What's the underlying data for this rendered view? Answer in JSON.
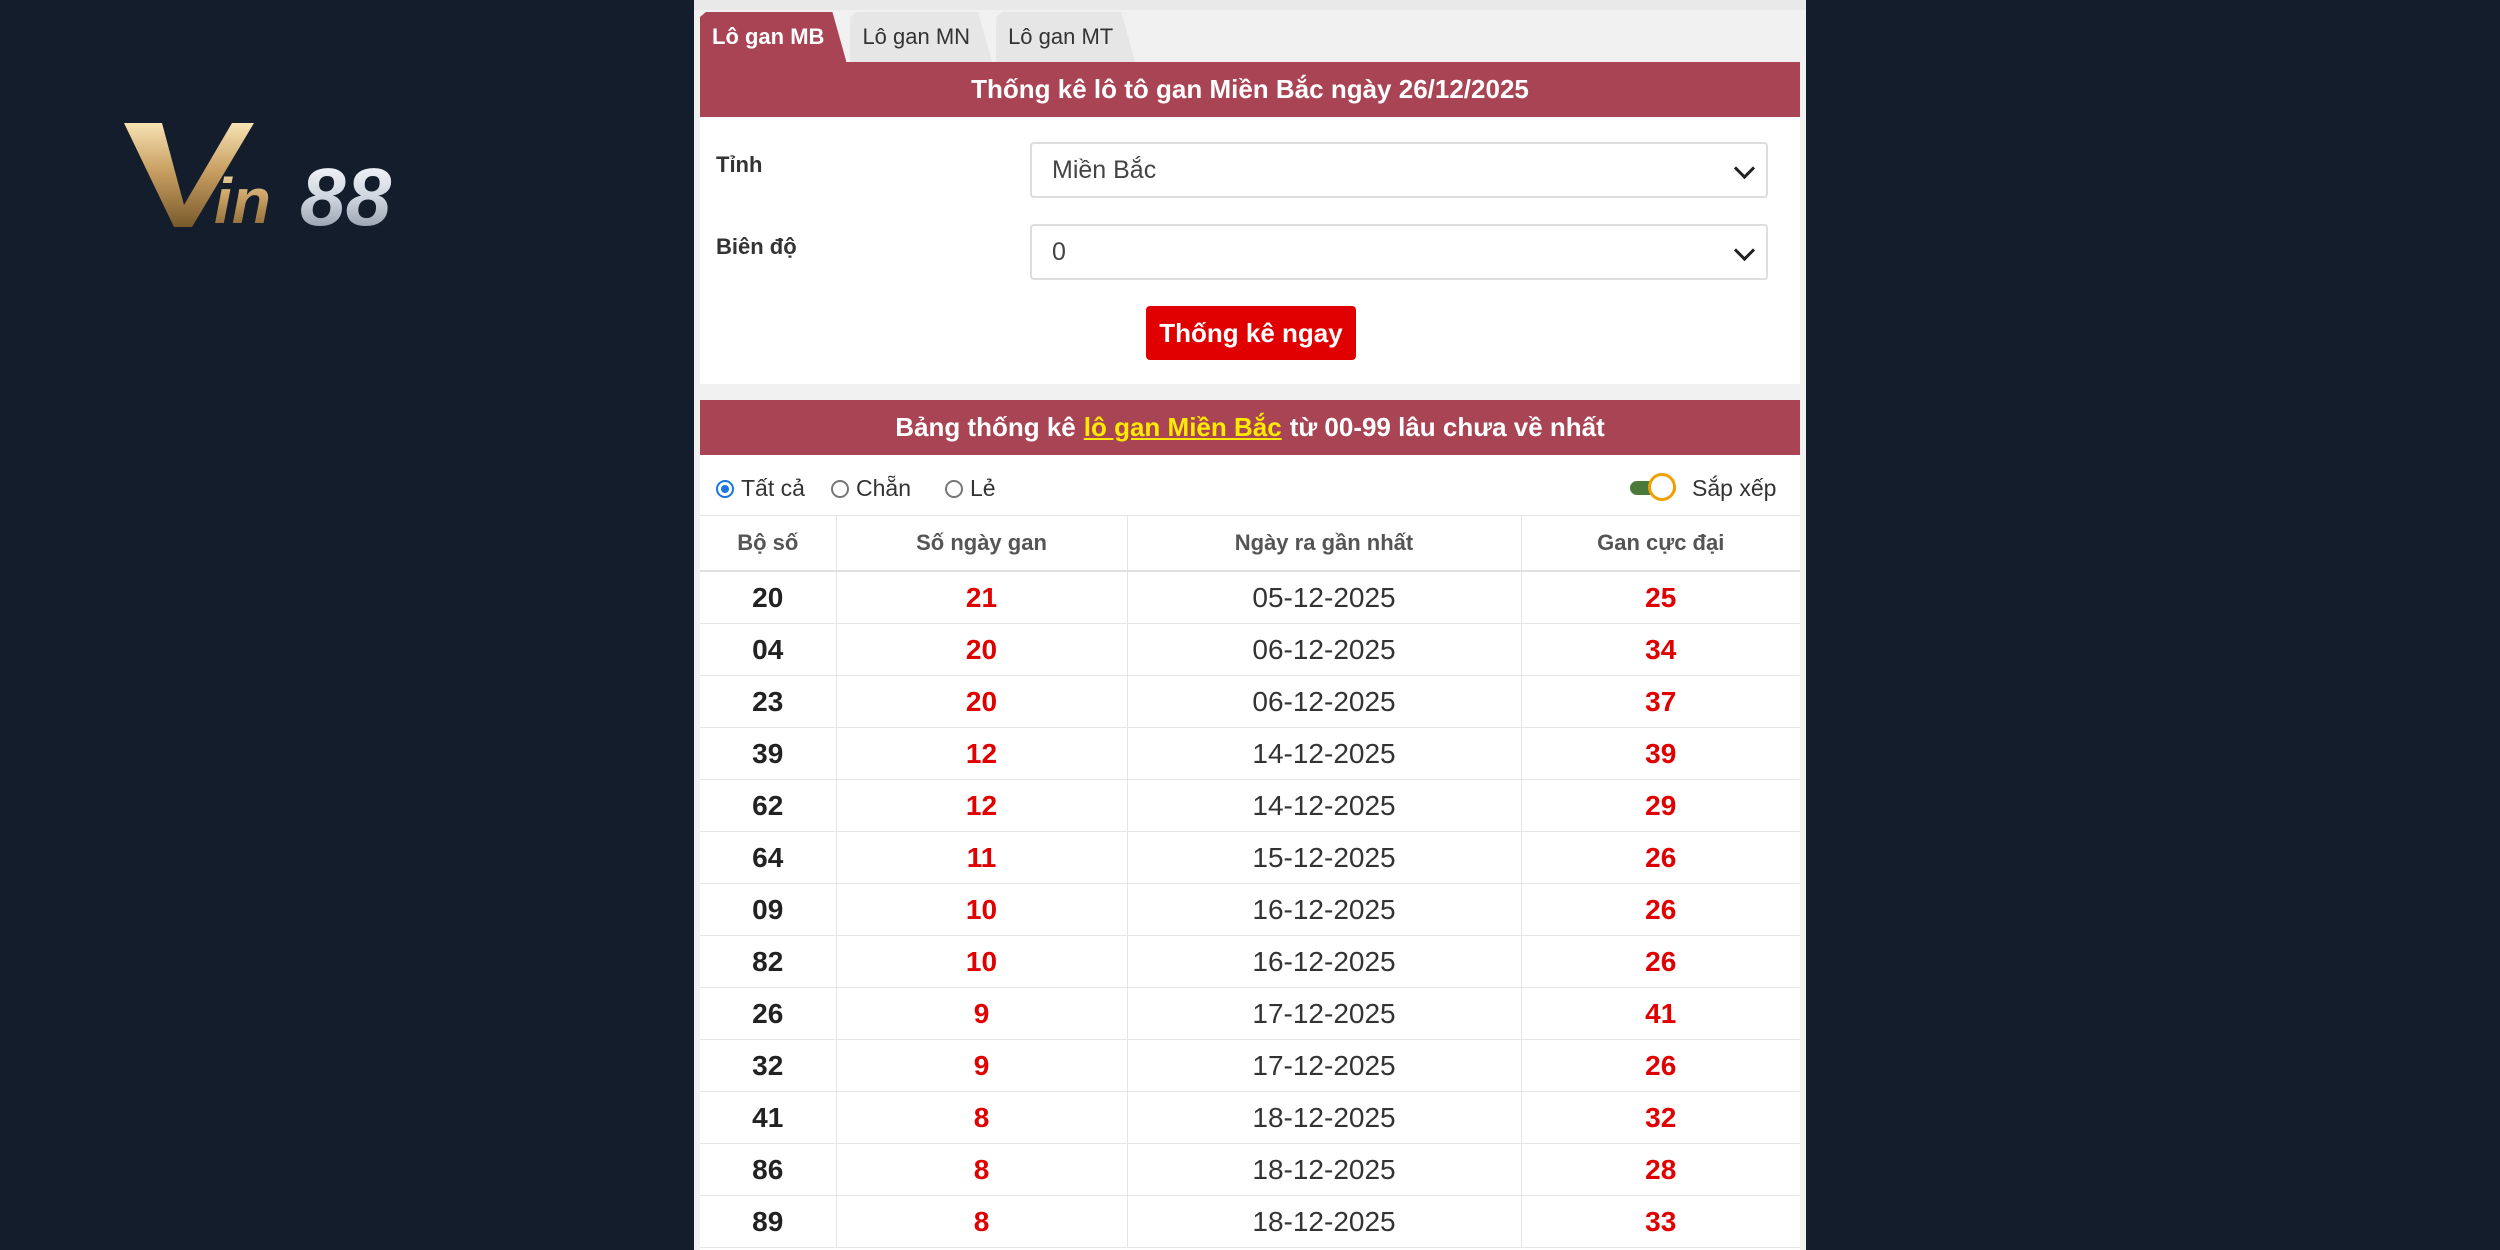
{
  "logo": {
    "text": "Vin88"
  },
  "tabs": [
    {
      "label": "Lô gan MB",
      "active": true
    },
    {
      "label": "Lô gan MN",
      "active": false
    },
    {
      "label": "Lô gan MT",
      "active": false
    }
  ],
  "form": {
    "title": "Thống kê lô tô gan Miền Bắc ngày 26/12/2025",
    "province_label": "Tỉnh",
    "province_value": "Miền Bắc",
    "range_label": "Biên độ",
    "range_value": "0",
    "submit_label": "Thống kê ngay"
  },
  "table_card": {
    "title_prefix": "Bảng thống kê",
    "title_highlight": "lô gan Miền Bắc",
    "title_suffix": "từ 00-99 lâu chưa về nhất",
    "filters": {
      "all": "Tất cả",
      "even": "Chẵn",
      "odd": "Lẻ",
      "selected": "all"
    },
    "sort_label": "Sắp xếp",
    "sort_on": true,
    "columns": [
      "Bộ số",
      "Số ngày gan",
      "Ngày ra gần nhất",
      "Gan cực đại"
    ],
    "rows": [
      [
        "20",
        "21",
        "05-12-2025",
        "25"
      ],
      [
        "04",
        "20",
        "06-12-2025",
        "34"
      ],
      [
        "23",
        "20",
        "06-12-2025",
        "37"
      ],
      [
        "39",
        "12",
        "14-12-2025",
        "39"
      ],
      [
        "62",
        "12",
        "14-12-2025",
        "29"
      ],
      [
        "64",
        "11",
        "15-12-2025",
        "26"
      ],
      [
        "09",
        "10",
        "16-12-2025",
        "26"
      ],
      [
        "82",
        "10",
        "16-12-2025",
        "26"
      ],
      [
        "26",
        "9",
        "17-12-2025",
        "41"
      ],
      [
        "32",
        "9",
        "17-12-2025",
        "26"
      ],
      [
        "41",
        "8",
        "18-12-2025",
        "32"
      ],
      [
        "86",
        "8",
        "18-12-2025",
        "28"
      ],
      [
        "89",
        "8",
        "18-12-2025",
        "33"
      ]
    ]
  },
  "colors": {
    "background": "#141d2c",
    "header_red": "#a84453",
    "accent_red": "#e00000",
    "highlight_yellow": "#ffea00"
  }
}
